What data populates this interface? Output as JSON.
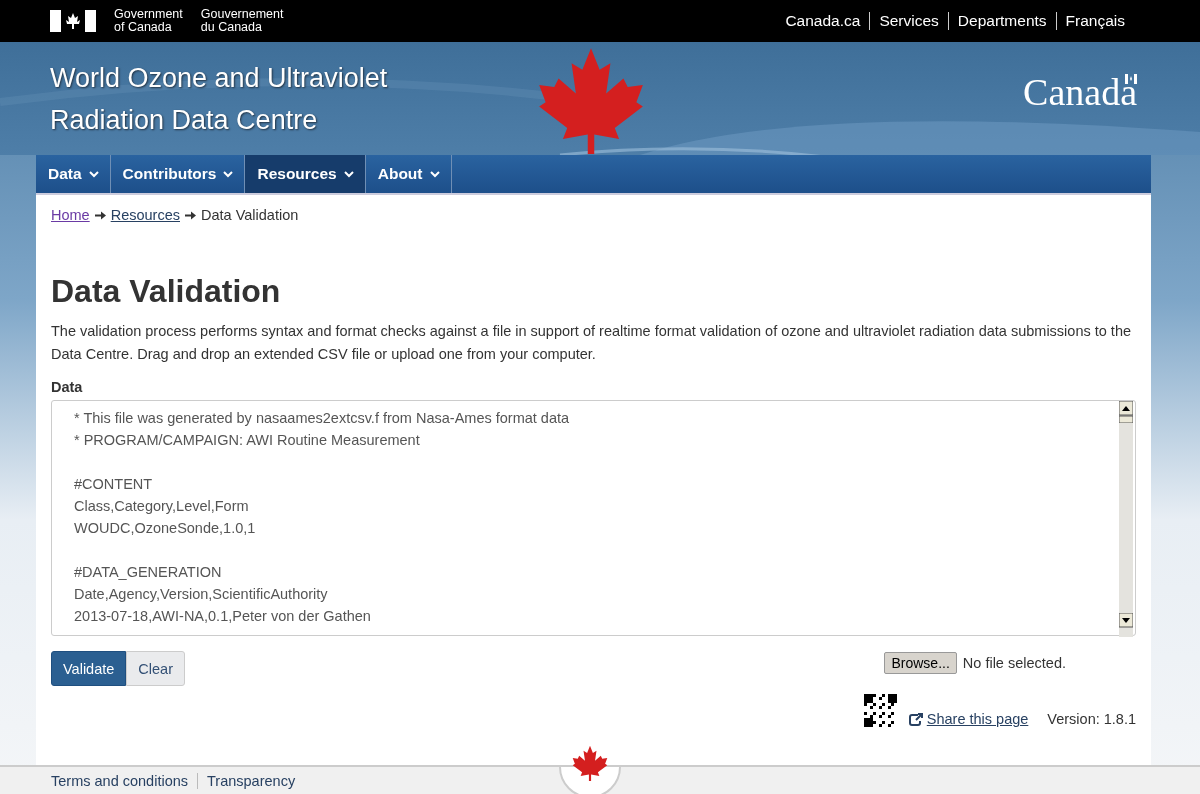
{
  "top_bar": {
    "government_en": [
      "Government",
      "of Canada"
    ],
    "government_fr": [
      "Gouvernement",
      "du Canada"
    ],
    "links": [
      "Canada.ca",
      "Services",
      "Departments",
      "Français"
    ]
  },
  "banner": {
    "title_lines": [
      "World Ozone and Ultraviolet",
      "Radiation Data Centre"
    ],
    "wordmark": "Canada"
  },
  "nav": [
    {
      "label": "Data",
      "selected": false
    },
    {
      "label": "Contributors",
      "selected": false
    },
    {
      "label": "Resources",
      "selected": true
    },
    {
      "label": "About",
      "selected": false
    }
  ],
  "breadcrumb": {
    "links": [
      {
        "label": "Home",
        "visited": true
      },
      {
        "label": "Resources",
        "visited": false
      }
    ],
    "current": "Data Validation"
  },
  "heading": "Data Validation",
  "intro": "The validation process performs syntax and format checks against a file in support of realtime format validation of ozone and ultraviolet radiation data submissions to the Data Centre. Drag and drop an extended CSV file or upload one from your computer.",
  "data_field": {
    "label": "Data",
    "blocks": [
      [
        "* This file was generated by nasaames2extcsv.f from Nasa-Ames format data",
        "* PROGRAM/CAMPAIGN: AWI Routine Measurement"
      ],
      [
        "#CONTENT",
        "Class,Category,Level,Form",
        "WOUDC,OzoneSonde,1.0,1"
      ],
      [
        "#DATA_GENERATION",
        "Date,Agency,Version,ScientificAuthority",
        "2013-07-18,AWI-NA,0.1,Peter von der Gathen"
      ]
    ]
  },
  "buttons": [
    {
      "label": "Validate",
      "kind": "primary"
    },
    {
      "label": "Clear",
      "kind": "secondary"
    }
  ],
  "file_input": {
    "button": "Browse...",
    "status": "No file selected."
  },
  "share_link": "Share this page",
  "version": "Version: 1.8.1",
  "footer": {
    "links": [
      "Terms and conditions",
      "Transparency"
    ]
  }
}
